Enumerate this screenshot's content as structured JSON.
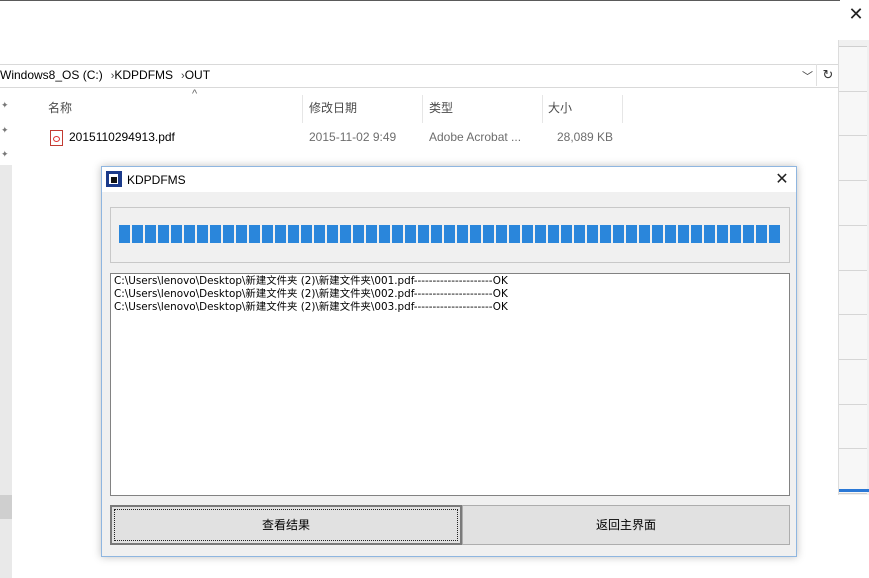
{
  "explorer": {
    "close_glyph": "✕",
    "breadcrumb": [
      "Windows8_OS (C:)",
      "KDPDFMS",
      "OUT"
    ],
    "breadcrumb_sep": "›",
    "columns": [
      "名称",
      "修改日期",
      "类型",
      "大小"
    ],
    "files": [
      {
        "name": "2015110294913.pdf",
        "modified": "2015-11-02 9:49",
        "type": "Adobe Acrobat ...",
        "size": "28,089 KB",
        "icon": "pdf-file-icon"
      }
    ]
  },
  "dialog": {
    "title": "KDPDFMS",
    "close_glyph": "✕",
    "progress_fraction": 1.0,
    "progress_color": "#2a86db",
    "log_lines": [
      "C:\\Users\\lenovo\\Desktop\\新建文件夹 (2)\\新建文件夹\\001.pdf---------------------OK",
      "C:\\Users\\lenovo\\Desktop\\新建文件夹 (2)\\新建文件夹\\002.pdf---------------------OK",
      "C:\\Users\\lenovo\\Desktop\\新建文件夹 (2)\\新建文件夹\\003.pdf---------------------OK"
    ],
    "buttons": {
      "view_results": "查看结果",
      "back_to_main": "返回主界面"
    }
  }
}
